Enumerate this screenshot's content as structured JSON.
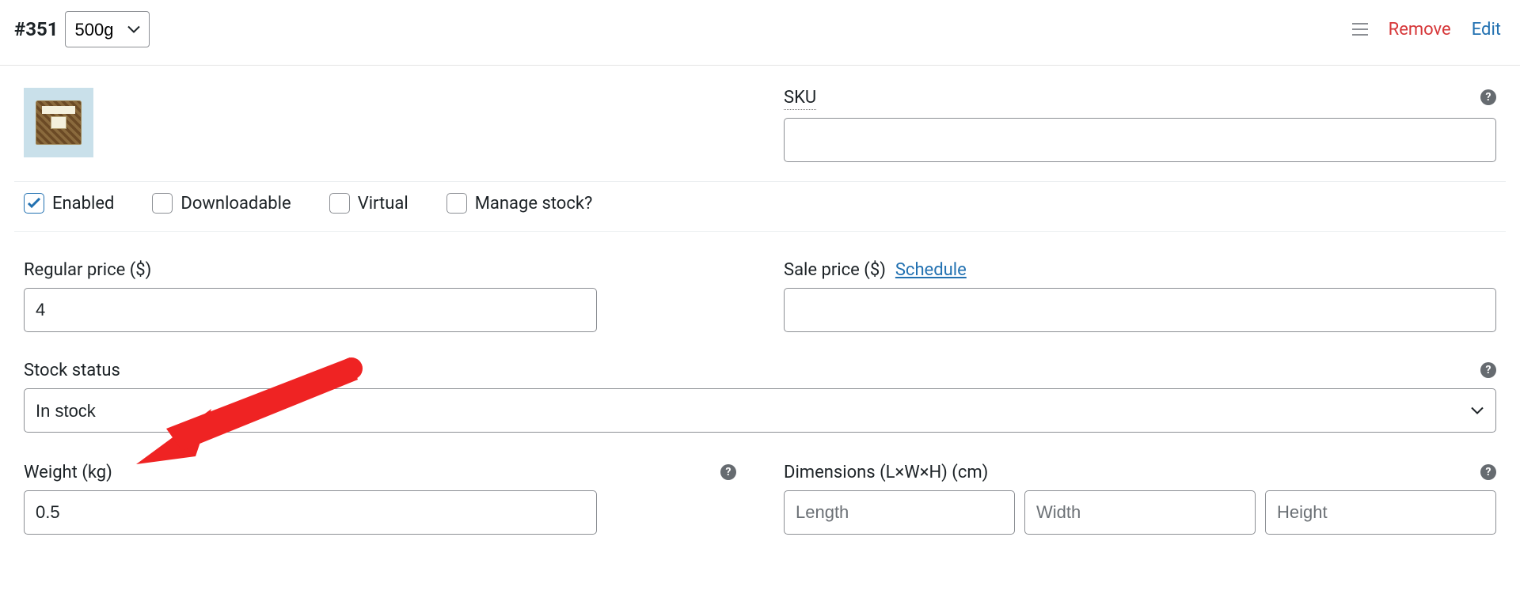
{
  "colors": {
    "danger": "#d63638",
    "link": "#2271b1",
    "border": "#8c8f94"
  },
  "header": {
    "variation_id_prefix": "#",
    "variation_id": "351",
    "attribute_options": [
      "500g"
    ],
    "attribute_selected": "500g",
    "remove_label": "Remove",
    "edit_label": "Edit"
  },
  "sku": {
    "label": "SKU",
    "value": ""
  },
  "checkboxes": {
    "enabled": {
      "label": "Enabled",
      "checked": true
    },
    "downloadable": {
      "label": "Downloadable",
      "checked": false
    },
    "virtual": {
      "label": "Virtual",
      "checked": false
    },
    "manage_stock": {
      "label": "Manage stock?",
      "checked": false
    }
  },
  "regular_price": {
    "label": "Regular price ($)",
    "value": "4"
  },
  "sale_price": {
    "label": "Sale price ($)",
    "schedule_label": "Schedule",
    "value": ""
  },
  "stock_status": {
    "label": "Stock status",
    "selected": "In stock",
    "options": [
      "In stock"
    ]
  },
  "weight": {
    "label": "Weight (kg)",
    "value": "0.5"
  },
  "dimensions": {
    "label": "Dimensions (L×W×H) (cm)",
    "length": {
      "placeholder": "Length",
      "value": ""
    },
    "width": {
      "placeholder": "Width",
      "value": ""
    },
    "height": {
      "placeholder": "Height",
      "value": ""
    }
  }
}
